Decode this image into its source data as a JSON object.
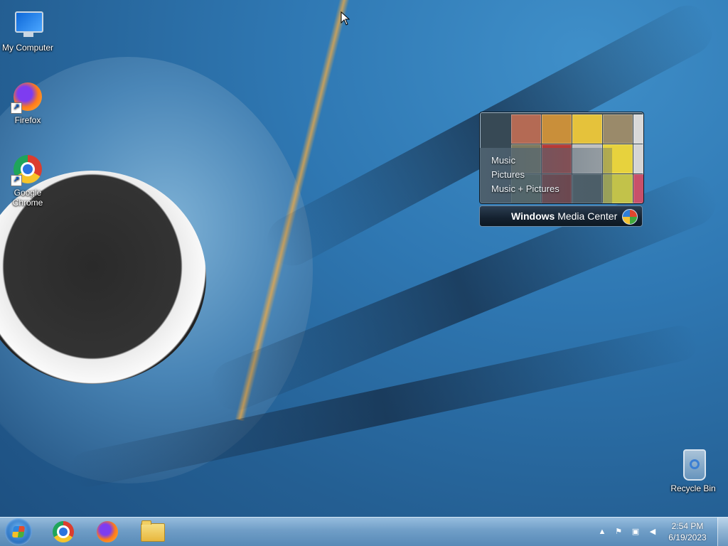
{
  "desktop": {
    "icons": [
      {
        "label": "My Computer",
        "icon": "computer-icon"
      },
      {
        "label": "Firefox",
        "icon": "firefox-icon"
      },
      {
        "label": "Google Chrome",
        "icon": "chrome-icon"
      },
      {
        "label": "Recycle Bin",
        "icon": "recycle-bin-icon"
      }
    ]
  },
  "media_center": {
    "menu": [
      "Music",
      "Pictures",
      "Music + Pictures"
    ],
    "title_bold": "Windows",
    "title_rest": " Media Center"
  },
  "taskbar": {
    "pinned": [
      {
        "name": "Google Chrome",
        "icon": "chrome-icon"
      },
      {
        "name": "Firefox",
        "icon": "firefox-icon"
      },
      {
        "name": "Windows Explorer",
        "icon": "folder-icon"
      }
    ],
    "tray_icons": [
      "show-hidden-icons-arrow",
      "action-center-flag-icon",
      "network-icon",
      "volume-muted-icon"
    ],
    "clock": {
      "time": "2:54 PM",
      "date": "6/19/2023"
    }
  },
  "colors": {
    "desktop_bg": "#2f78b3",
    "taskbar": "#78a5cd"
  }
}
